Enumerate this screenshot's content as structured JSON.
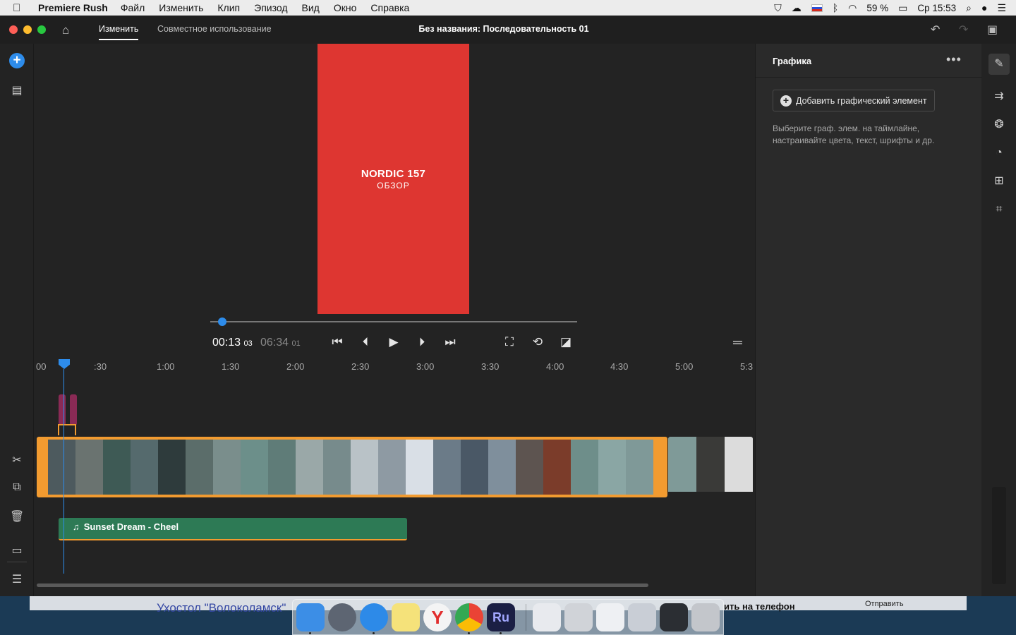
{
  "menubar": {
    "apple": "",
    "app_name": "Premiere Rush",
    "items": [
      "Файл",
      "Изменить",
      "Клип",
      "Эпизод",
      "Вид",
      "Окно",
      "Справка"
    ],
    "battery": "59 %",
    "clock": "Ср 15:53"
  },
  "titlebar": {
    "tab_edit": "Изменить",
    "tab_share": "Совместное использование",
    "document_title": "Без названия: Последовательность 01"
  },
  "preview": {
    "title": "NORDIC 157",
    "subtitle": "ОБЗОР",
    "timecode_current": "00:13",
    "timecode_current_frames": "03",
    "timecode_duration": "06:34",
    "timecode_duration_frames": "01",
    "progress_fraction": 0.033
  },
  "timeline": {
    "ruler": [
      "00",
      ":30",
      "1:00",
      "1:30",
      "2:00",
      "2:30",
      "3:00",
      "3:30",
      "4:00",
      "4:30",
      "5:00",
      "5:3"
    ],
    "audio_clip_label": "Sunset Dream - Cheel",
    "thumb_colors": [
      "#4d5a5e",
      "#6a7370",
      "#3e5a55",
      "#556a6d",
      "#2e3b3c",
      "#5b6d6a",
      "#7a8e8c",
      "#6c8f8a",
      "#5f7c78",
      "#9aa8a8",
      "#778b8c",
      "#b9c2c7",
      "#8e9aa3",
      "#d9dfe6",
      "#6b7b88",
      "#4a5866",
      "#7f8f9c",
      "#5d5450",
      "#7b3c2a",
      "#6e8e8a",
      "#8aa6a4",
      "#7f9998"
    ],
    "thumb_colors_2": [
      "#7f9a98",
      "#3a3a38",
      "#dcdcdc"
    ]
  },
  "panel": {
    "title": "Графика",
    "add_button": "Добавить графический элемент",
    "hint": "Выберите граф. элем. на таймлайне, настраивайте цвета, текст, шрифты и др."
  },
  "background": {
    "text_left": "Ухостол \"Волоколамск\"",
    "text_right": "ить на телефон",
    "send_button": "Отправить"
  },
  "colors": {
    "accent": "#2d8ceb",
    "preview_bg": "#de3631",
    "clip_border": "#f29b30",
    "audio_clip": "#2d7a55",
    "graphic_clip": "#8a2a55"
  }
}
